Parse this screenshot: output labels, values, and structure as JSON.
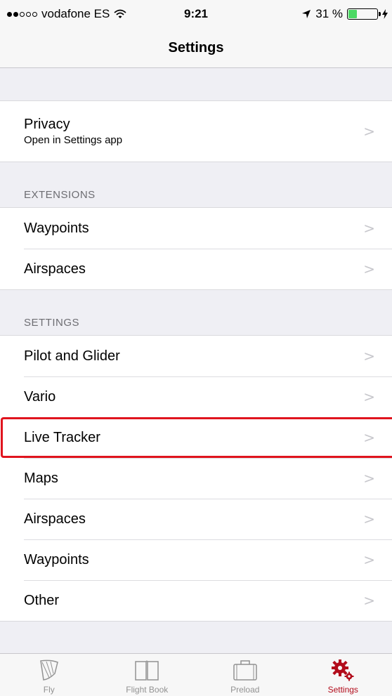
{
  "status_bar": {
    "carrier": "vodafone ES",
    "time": "9:21",
    "battery_text": "31 %",
    "battery_level": 0.31,
    "battery_color": "#4cd964"
  },
  "nav": {
    "title": "Settings"
  },
  "privacy": {
    "label": "Privacy",
    "subtitle": "Open in Settings app"
  },
  "extensions": {
    "header": "EXTENSIONS",
    "items": [
      {
        "label": "Waypoints"
      },
      {
        "label": "Airspaces"
      }
    ]
  },
  "settings": {
    "header": "SETTINGS",
    "items": [
      {
        "label": "Pilot and Glider"
      },
      {
        "label": "Vario"
      },
      {
        "label": "Live Tracker"
      },
      {
        "label": "Maps"
      },
      {
        "label": "Airspaces"
      },
      {
        "label": "Waypoints"
      },
      {
        "label": "Other"
      }
    ]
  },
  "chevron": ">",
  "tabs": [
    {
      "label": "Fly",
      "icon": "glider-icon"
    },
    {
      "label": "Flight Book",
      "icon": "book-icon"
    },
    {
      "label": "Preload",
      "icon": "briefcase-icon"
    },
    {
      "label": "Settings",
      "icon": "gears-icon",
      "active": true
    }
  ],
  "colors": {
    "accent": "#b20c1b",
    "highlight_border": "#e0141e",
    "chevron": "#c7c7cc",
    "inactive_tab": "#929292"
  }
}
